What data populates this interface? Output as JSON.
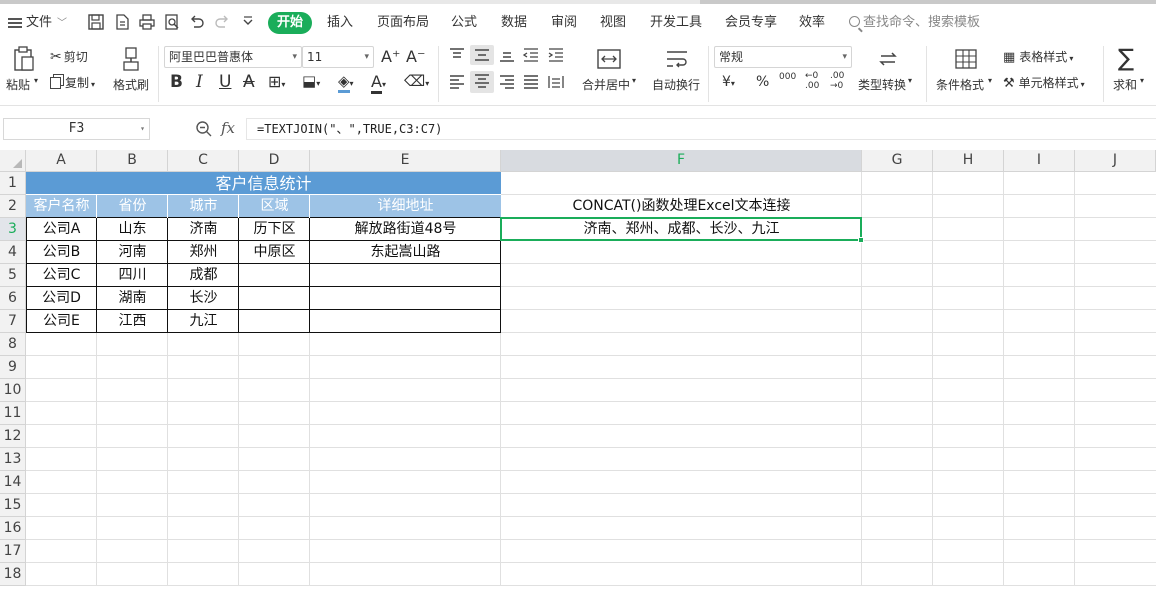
{
  "menubar": {
    "file_label": "文件",
    "tabs": [
      "开始",
      "插入",
      "页面布局",
      "公式",
      "数据",
      "审阅",
      "视图",
      "开发工具",
      "会员专享",
      "效率"
    ],
    "search_placeholder": "查找命令、搜索模板"
  },
  "ribbon": {
    "paste": "粘贴",
    "cut": "剪切",
    "copy": "复制",
    "format_painter": "格式刷",
    "font_name": "阿里巴巴普惠体",
    "font_size": "11",
    "merge_center": "合并居中",
    "wrap_text": "自动换行",
    "number_format": "常规",
    "type_convert": "类型转换",
    "conditional_format": "条件格式",
    "table_style": "表格样式",
    "cell_style": "单元格样式",
    "sum": "求和",
    "percent": "%",
    "thousands": "000"
  },
  "formula_bar": {
    "name_box": "F3",
    "fx": "fx",
    "formula": "=TEXTJOIN(\"、\",TRUE,C3:C7)"
  },
  "sheet": {
    "columns": [
      "A",
      "B",
      "C",
      "D",
      "E",
      "F",
      "G",
      "H",
      "I",
      "J"
    ],
    "rows": [
      "1",
      "2",
      "3",
      "4",
      "5",
      "6",
      "7",
      "8",
      "9",
      "10",
      "11",
      "12",
      "13",
      "14",
      "15",
      "16",
      "17",
      "18"
    ],
    "selected_cell": "F3",
    "table_title": "客户信息统计",
    "headers": [
      "客户名称",
      "省份",
      "城市",
      "区域",
      "详细地址"
    ],
    "data_rows": [
      [
        "公司A",
        "山东",
        "济南",
        "历下区",
        "解放路街道48号"
      ],
      [
        "公司B",
        "河南",
        "郑州",
        "中原区",
        "东起嵩山路"
      ],
      [
        "公司C",
        "四川",
        "成都",
        "",
        ""
      ],
      [
        "公司D",
        "湖南",
        "长沙",
        "",
        ""
      ],
      [
        "公司E",
        "江西",
        "九江",
        "",
        ""
      ]
    ],
    "f2_label": "CONCAT()函数处理Excel文本连接",
    "f3_result": "济南、郑州、成都、长沙、九江"
  },
  "colors": {
    "accent": "#1aad5a",
    "title_fill": "#5b9bd5",
    "header_fill": "#9dc3e6"
  }
}
